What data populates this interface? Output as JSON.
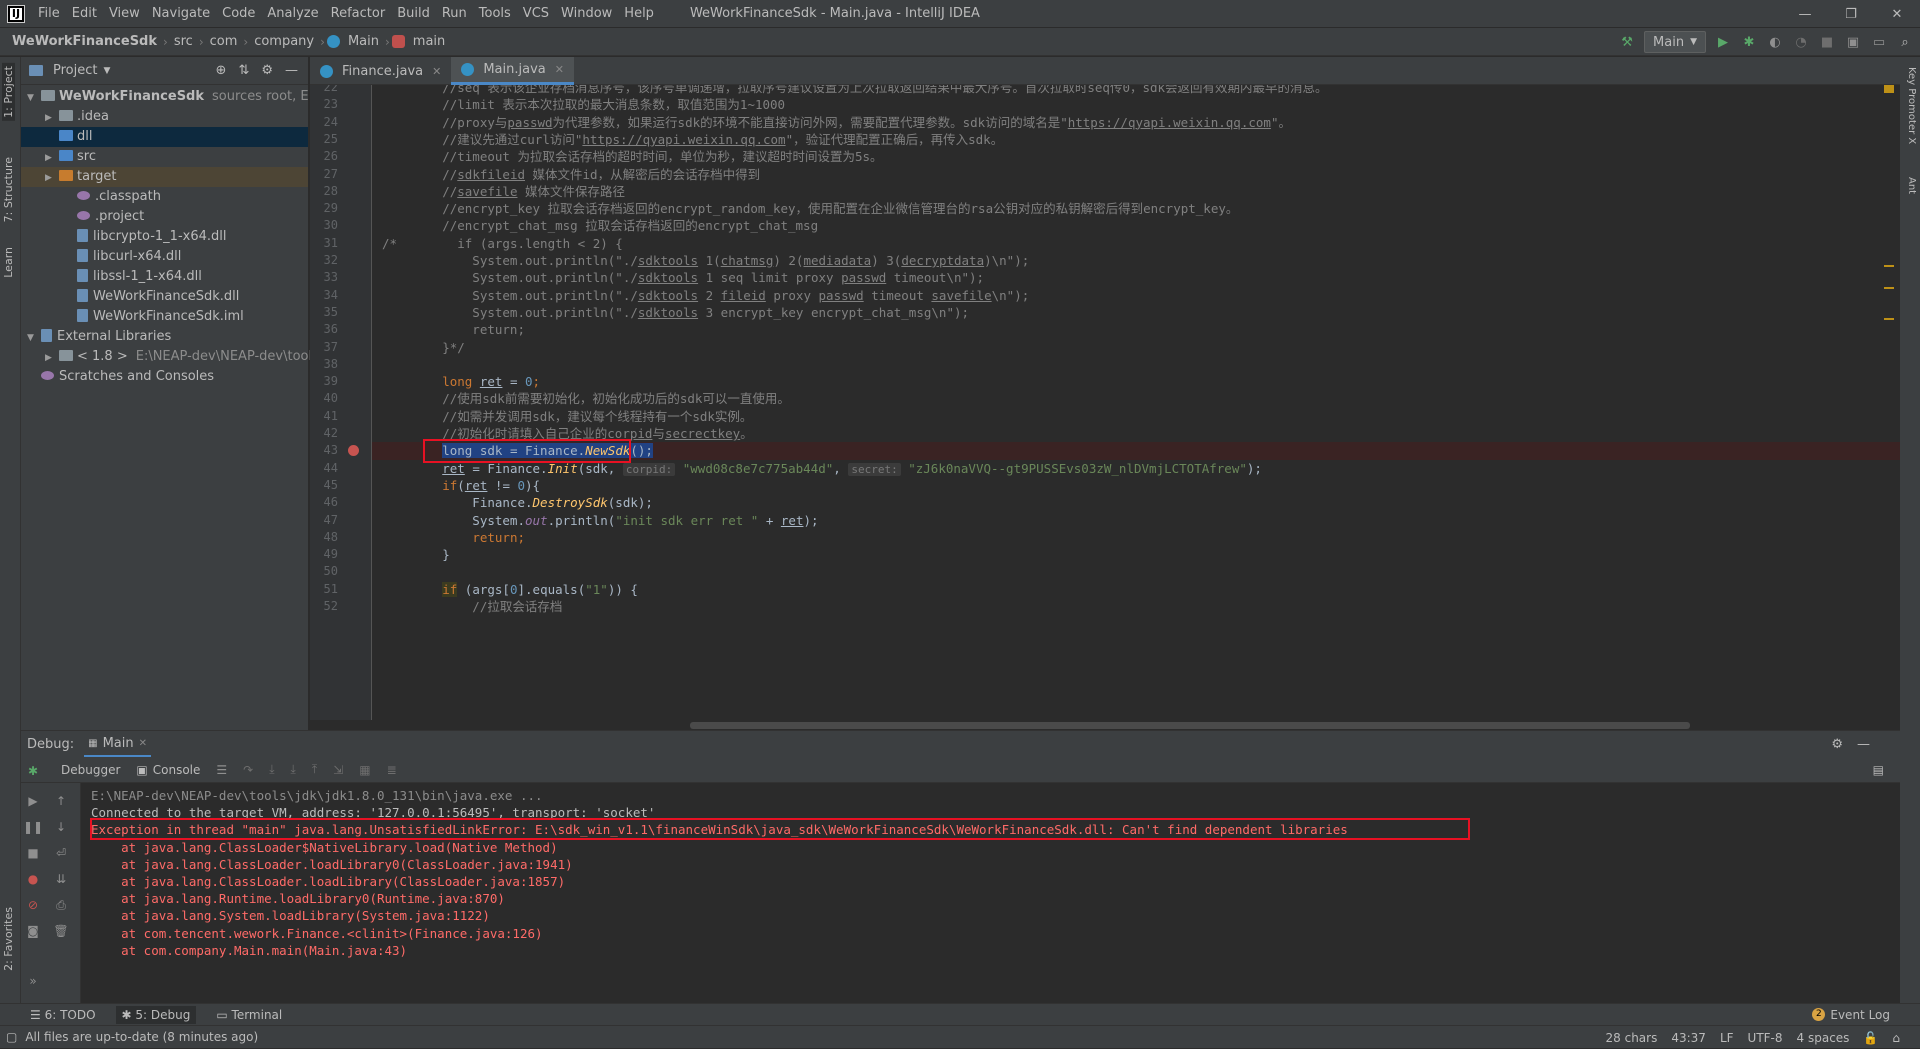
{
  "window": {
    "app_icon": "IJ",
    "title": "WeWorkFinanceSdk - Main.java - IntelliJ IDEA",
    "controls": [
      "—",
      "❐",
      "✕"
    ]
  },
  "menu": [
    "File",
    "Edit",
    "View",
    "Navigate",
    "Code",
    "Analyze",
    "Refactor",
    "Build",
    "Run",
    "Tools",
    "VCS",
    "Window",
    "Help"
  ],
  "breadcrumb": {
    "project": "WeWorkFinanceSdk",
    "path": [
      "src",
      "com",
      "company"
    ],
    "cls": "Main",
    "method": "main"
  },
  "toolbar": {
    "run_config": "Main"
  },
  "left_stripe": {
    "project": "1: Project",
    "structure": "7: Structure",
    "learn": "Learn",
    "favorites": "2: Favorites"
  },
  "right_stripe": {
    "key_promoter": "Key Promoter X",
    "ant": "Ant"
  },
  "project": {
    "header": "Project",
    "tree": [
      {
        "name": "WeWorkFinanceSdk",
        "extra": "sources root,  E:\\sdk",
        "indent": 0,
        "arrow": "▼",
        "icon": "folder"
      },
      {
        "name": ".idea",
        "indent": 1,
        "arrow": "▶",
        "icon": "folder"
      },
      {
        "name": "dll",
        "indent": 1,
        "arrow": "",
        "icon": "folder blue"
      },
      {
        "name": "src",
        "indent": 1,
        "arrow": "▶",
        "icon": "folder blue"
      },
      {
        "name": "target",
        "indent": 1,
        "arrow": "▶",
        "icon": "folder orange"
      },
      {
        "name": ".classpath",
        "indent": 2,
        "arrow": "",
        "icon": "cfg"
      },
      {
        "name": ".project",
        "indent": 2,
        "arrow": "",
        "icon": "cfg"
      },
      {
        "name": "libcrypto-1_1-x64.dll",
        "indent": 2,
        "arrow": "",
        "icon": "lib"
      },
      {
        "name": "libcurl-x64.dll",
        "indent": 2,
        "arrow": "",
        "icon": "lib"
      },
      {
        "name": "libssl-1_1-x64.dll",
        "indent": 2,
        "arrow": "",
        "icon": "lib"
      },
      {
        "name": "WeWorkFinanceSdk.dll",
        "indent": 2,
        "arrow": "",
        "icon": "lib"
      },
      {
        "name": "WeWorkFinanceSdk.iml",
        "indent": 2,
        "arrow": "",
        "icon": "lib"
      },
      {
        "name": "External Libraries",
        "indent": 0,
        "arrow": "▼",
        "icon": "lib"
      },
      {
        "name": "< 1.8 >",
        "extra": "E:\\NEAP-dev\\NEAP-dev\\tools\\jd",
        "indent": 1,
        "arrow": "▶",
        "icon": "folder"
      },
      {
        "name": "Scratches and Consoles",
        "indent": 0,
        "arrow": "",
        "icon": "cfg"
      }
    ]
  },
  "editor_tabs": [
    {
      "label": "Finance.java"
    },
    {
      "label": "Main.java"
    }
  ],
  "editor": {
    "line_numbers": [
      "22",
      "23",
      "24",
      "25",
      "26",
      "27",
      "28",
      "29",
      "30",
      "31",
      "32",
      "33",
      "34",
      "35",
      "36",
      "37",
      "38",
      "39",
      "40",
      "41",
      "42",
      "43",
      "44",
      "45",
      "46",
      "47",
      "48",
      "49",
      "50",
      "51",
      "52"
    ],
    "lines": [
      [
        {
          "t": "        //seq 表示该企业存档消息序号，该序号单调递增，拉取序号建议设置为上次拉取返回结果中最大序号。首次拉取时seq传0，sdk会返回有效期内最早的消息。",
          "c": "cmt"
        }
      ],
      [
        {
          "t": "        //limit 表示本次拉取的最大消息条数，取值范围为1~1000",
          "c": "cmt"
        }
      ],
      [
        {
          "t": "        //proxy与",
          "c": "cmt"
        },
        {
          "t": "passwd",
          "c": "cmt und"
        },
        {
          "t": "为代理参数，如果运行sdk的环境不能直接访问外网，需要配置代理参数。sdk访问的域名是\"",
          "c": "cmt"
        },
        {
          "t": "https://qyapi.weixin.qq.com",
          "c": "cmt und"
        },
        {
          "t": "\"。",
          "c": "cmt"
        }
      ],
      [
        {
          "t": "        //建议先通过curl访问\"",
          "c": "cmt"
        },
        {
          "t": "https://qyapi.weixin.qq.com",
          "c": "cmt und"
        },
        {
          "t": "\"，验证代理配置正确后，再传入sdk。",
          "c": "cmt"
        }
      ],
      [
        {
          "t": "        //timeout 为拉取会话存档的超时时间，单位为秒，建议超时时间设置为5s。",
          "c": "cmt"
        }
      ],
      [
        {
          "t": "        //",
          "c": "cmt"
        },
        {
          "t": "sdkfileid",
          "c": "cmt und"
        },
        {
          "t": " 媒体文件id，从解密后的会话存档中得到",
          "c": "cmt"
        }
      ],
      [
        {
          "t": "        //",
          "c": "cmt"
        },
        {
          "t": "savefile",
          "c": "cmt und"
        },
        {
          "t": " 媒体文件保存路径",
          "c": "cmt"
        }
      ],
      [
        {
          "t": "        //encrypt_key 拉取会话存档返回的encrypt_random_key，使用配置在企业微信管理台的rsa公钥对应的私钥解密后得到encrypt_key。",
          "c": "cmt"
        }
      ],
      [
        {
          "t": "        //encrypt_chat_msg 拉取会话存档返回的encrypt_chat_msg",
          "c": "cmt"
        }
      ],
      [
        {
          "t": "/*",
          "c": "cmt"
        },
        {
          "t": "        if (args.length < 2) {",
          "c": "cmt"
        }
      ],
      [
        {
          "t": "            System.out.println(\"./",
          "c": "cmt"
        },
        {
          "t": "sdktools",
          "c": "cmt und"
        },
        {
          "t": " 1(",
          "c": "cmt"
        },
        {
          "t": "chatmsg",
          "c": "cmt und"
        },
        {
          "t": ") 2(",
          "c": "cmt"
        },
        {
          "t": "mediadata",
          "c": "cmt und"
        },
        {
          "t": ") 3(",
          "c": "cmt"
        },
        {
          "t": "decryptdata",
          "c": "cmt und"
        },
        {
          "t": ")\\n\");",
          "c": "cmt"
        }
      ],
      [
        {
          "t": "            System.out.println(\"./",
          "c": "cmt"
        },
        {
          "t": "sdktools",
          "c": "cmt und"
        },
        {
          "t": " 1 seq limit proxy ",
          "c": "cmt"
        },
        {
          "t": "passwd",
          "c": "cmt und"
        },
        {
          "t": " timeout\\n\");",
          "c": "cmt"
        }
      ],
      [
        {
          "t": "            System.out.println(\"./",
          "c": "cmt"
        },
        {
          "t": "sdktools",
          "c": "cmt und"
        },
        {
          "t": " 2 ",
          "c": "cmt"
        },
        {
          "t": "fileid",
          "c": "cmt und"
        },
        {
          "t": " proxy ",
          "c": "cmt"
        },
        {
          "t": "passwd",
          "c": "cmt und"
        },
        {
          "t": " timeout ",
          "c": "cmt"
        },
        {
          "t": "savefile",
          "c": "cmt und"
        },
        {
          "t": "\\n\");",
          "c": "cmt"
        }
      ],
      [
        {
          "t": "            System.out.println(\"./",
          "c": "cmt"
        },
        {
          "t": "sdktools",
          "c": "cmt und"
        },
        {
          "t": " 3 encrypt_key encrypt_chat_msg\\n\");",
          "c": "cmt"
        }
      ],
      [
        {
          "t": "            return;",
          "c": "cmt"
        }
      ],
      [
        {
          "t": "        }*/",
          "c": "cmt"
        }
      ],
      [
        {
          "t": "",
          "c": ""
        }
      ],
      [
        {
          "t": "        ",
          "c": ""
        },
        {
          "t": "long ",
          "c": "kw"
        },
        {
          "t": "ret",
          "c": "und"
        },
        {
          "t": " = ",
          "c": ""
        },
        {
          "t": "0",
          "c": "num"
        },
        {
          "t": ";",
          "c": "kw"
        }
      ],
      [
        {
          "t": "        //使用sdk前需要初始化，初始化成功后的sdk可以一直使用。",
          "c": "cmt"
        }
      ],
      [
        {
          "t": "        //如需并发调用sdk，建议每个线程持有一个sdk实例。",
          "c": "cmt"
        }
      ],
      [
        {
          "t": "        //初始化时请填入自己企业的",
          "c": "cmt"
        },
        {
          "t": "corpid",
          "c": "cmt und"
        },
        {
          "t": "与",
          "c": "cmt"
        },
        {
          "t": "secrectkey",
          "c": "cmt und"
        },
        {
          "t": "。",
          "c": "cmt"
        }
      ],
      [
        {
          "t": "        ",
          "c": ""
        },
        {
          "t": "long sdk = Finance.",
          "c": "sel-text"
        },
        {
          "t": "NewSdk",
          "c": "sel-text fi"
        },
        {
          "t": "();",
          "c": "sel-text"
        }
      ],
      [
        {
          "t": "        ",
          "c": ""
        },
        {
          "t": "ret",
          "c": "und"
        },
        {
          "t": " = Finance.",
          "c": ""
        },
        {
          "t": "Init",
          "c": "fi"
        },
        {
          "t": "(sdk, ",
          "c": ""
        },
        {
          "t": "corpid:",
          "c": "hint"
        },
        {
          "t": " ",
          "c": ""
        },
        {
          "t": "\"wwd08c8e7c775ab44d\"",
          "c": "str"
        },
        {
          "t": ", ",
          "c": ""
        },
        {
          "t": "secret:",
          "c": "hint"
        },
        {
          "t": " ",
          "c": ""
        },
        {
          "t": "\"zJ6k0naVVQ--gt9PUSSEvs03zW_nlDVmjLCTOTAfrew\"",
          "c": "str"
        },
        {
          "t": ");",
          "c": ""
        }
      ],
      [
        {
          "t": "        ",
          "c": ""
        },
        {
          "t": "if",
          "c": "kw"
        },
        {
          "t": "(",
          "c": ""
        },
        {
          "t": "ret",
          "c": "und"
        },
        {
          "t": " != ",
          "c": ""
        },
        {
          "t": "0",
          "c": "num"
        },
        {
          "t": "){",
          "c": ""
        }
      ],
      [
        {
          "t": "            Finance.",
          "c": ""
        },
        {
          "t": "DestroySdk",
          "c": "fi"
        },
        {
          "t": "(sdk);",
          "c": ""
        }
      ],
      [
        {
          "t": "            System.",
          "c": ""
        },
        {
          "t": "out",
          "c": "fld"
        },
        {
          "t": ".println(",
          "c": ""
        },
        {
          "t": "\"init sdk err ret \"",
          "c": "str"
        },
        {
          "t": " + ",
          "c": ""
        },
        {
          "t": "ret",
          "c": "und"
        },
        {
          "t": ");",
          "c": ""
        }
      ],
      [
        {
          "t": "            ",
          "c": ""
        },
        {
          "t": "return",
          "c": "kw"
        },
        {
          "t": ";",
          "c": "kw"
        }
      ],
      [
        {
          "t": "        }",
          "c": ""
        }
      ],
      [
        {
          "t": "",
          "c": ""
        }
      ],
      [
        {
          "t": "        ",
          "c": ""
        },
        {
          "t": "if",
          "c": "kw ifhl"
        },
        {
          "t": " (args[",
          "c": ""
        },
        {
          "t": "0",
          "c": "num"
        },
        {
          "t": "].equals(",
          "c": ""
        },
        {
          "t": "\"1\"",
          "c": "str"
        },
        {
          "t": ")) {",
          "c": ""
        }
      ],
      [
        {
          "t": "            //拉取会话存档",
          "c": "cmt"
        }
      ]
    ]
  },
  "debug": {
    "label": "Debug:",
    "session": "Main",
    "subtabs": {
      "debugger": "Debugger",
      "console": "Console"
    },
    "console": [
      {
        "t": "E:\\NEAP-dev\\NEAP-dev\\tools\\jdk\\jdk1.8.0_131\\bin\\java.exe ...",
        "c": "gray"
      },
      {
        "t": "Connected to the target VM, address: '127.0.0.1:56495', transport: 'socket'",
        "c": ""
      },
      {
        "t": "Exception in thread \"main\" java.lang.UnsatisfiedLinkError: E:\\sdk_win_v1.1\\financeWinSdk\\java_sdk\\WeWorkFinanceSdk\\WeWorkFinanceSdk.dll: Can't find dependent libraries",
        "c": "err"
      },
      {
        "t": "\tat java.lang.ClassLoader$NativeLibrary.load(Native Method)",
        "c": "err"
      },
      {
        "t": "\tat java.lang.ClassLoader.loadLibrary0(ClassLoader.java:1941)",
        "c": "err"
      },
      {
        "t": "\tat java.lang.ClassLoader.loadLibrary(ClassLoader.java:1857)",
        "c": "err"
      },
      {
        "t": "\tat java.lang.Runtime.loadLibrary0(Runtime.java:870)",
        "c": "err"
      },
      {
        "t": "\tat java.lang.System.loadLibrary(System.java:1122)",
        "c": "err"
      },
      {
        "t": "\tat com.tencent.wework.Finance.<clinit>(Finance.java:126)",
        "c": "err"
      },
      {
        "t": "\tat com.company.Main.main(Main.java:43)",
        "c": "err"
      }
    ]
  },
  "bottom_tabs": {
    "todo": "6: TODO",
    "debug": "5: Debug",
    "terminal": "Terminal"
  },
  "event_log": "Event Log",
  "status": {
    "message": "All files are up-to-date (8 minutes ago)",
    "chars": "28 chars",
    "position": "43:37",
    "line_sep": "LF",
    "encoding": "UTF-8",
    "indent": "4 spaces"
  }
}
